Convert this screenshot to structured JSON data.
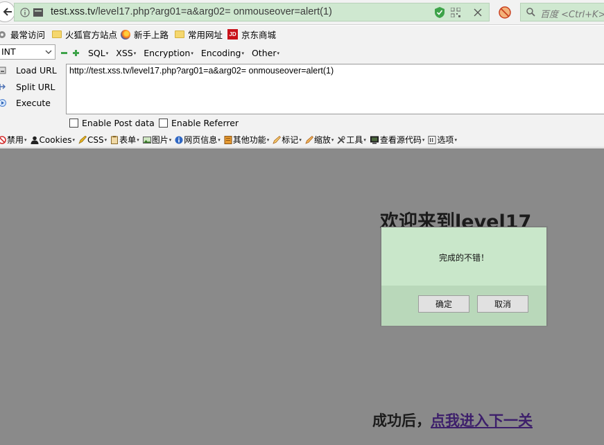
{
  "address_bar": {
    "url_host": "test.xss.tv",
    "url_rest": "/level17.php?arg01=a&arg02= onmouseover=alert(1)",
    "search_placeholder": "百度 <Ctrl+K>"
  },
  "bookmarks": [
    {
      "label": "最常访问",
      "icon": "gear-icon"
    },
    {
      "label": "火狐官方站点",
      "icon": "folder-icon"
    },
    {
      "label": "新手上路",
      "icon": "firefox-icon"
    },
    {
      "label": "常用网址",
      "icon": "folder-icon"
    },
    {
      "label": "京东商城",
      "icon": "jd-icon"
    }
  ],
  "hackbar": {
    "select_value": "INT",
    "menu": [
      "SQL",
      "XSS",
      "Encryption",
      "Encoding",
      "Other"
    ],
    "actions": [
      "Load URL",
      "Split URL",
      "Execute"
    ],
    "textarea_value": "http://test.xss.tv/level17.php?arg01=a&arg02= onmouseover=alert(1)",
    "enable_post": "Enable Post data",
    "enable_referrer": "Enable Referrer"
  },
  "webdev_toolbar": [
    "禁用",
    "Cookies",
    "CSS",
    "表单",
    "图片",
    "网页信息",
    "其他功能",
    "标记",
    "缩放",
    "工具",
    "查看源代码",
    "选项"
  ],
  "page": {
    "heading": "欢迎来到level17",
    "success_prefix": "成功后，",
    "success_link": "点我进入下一关"
  },
  "dialog": {
    "message": "完成的不错！",
    "ok_label": "确定",
    "cancel_label": "取消"
  },
  "colors": {
    "url_bg": "#cfe8d0",
    "overlay_bg": "#8a8a8a",
    "dialog_bg": "#c9e7ca",
    "link": "#3d1f6b"
  }
}
